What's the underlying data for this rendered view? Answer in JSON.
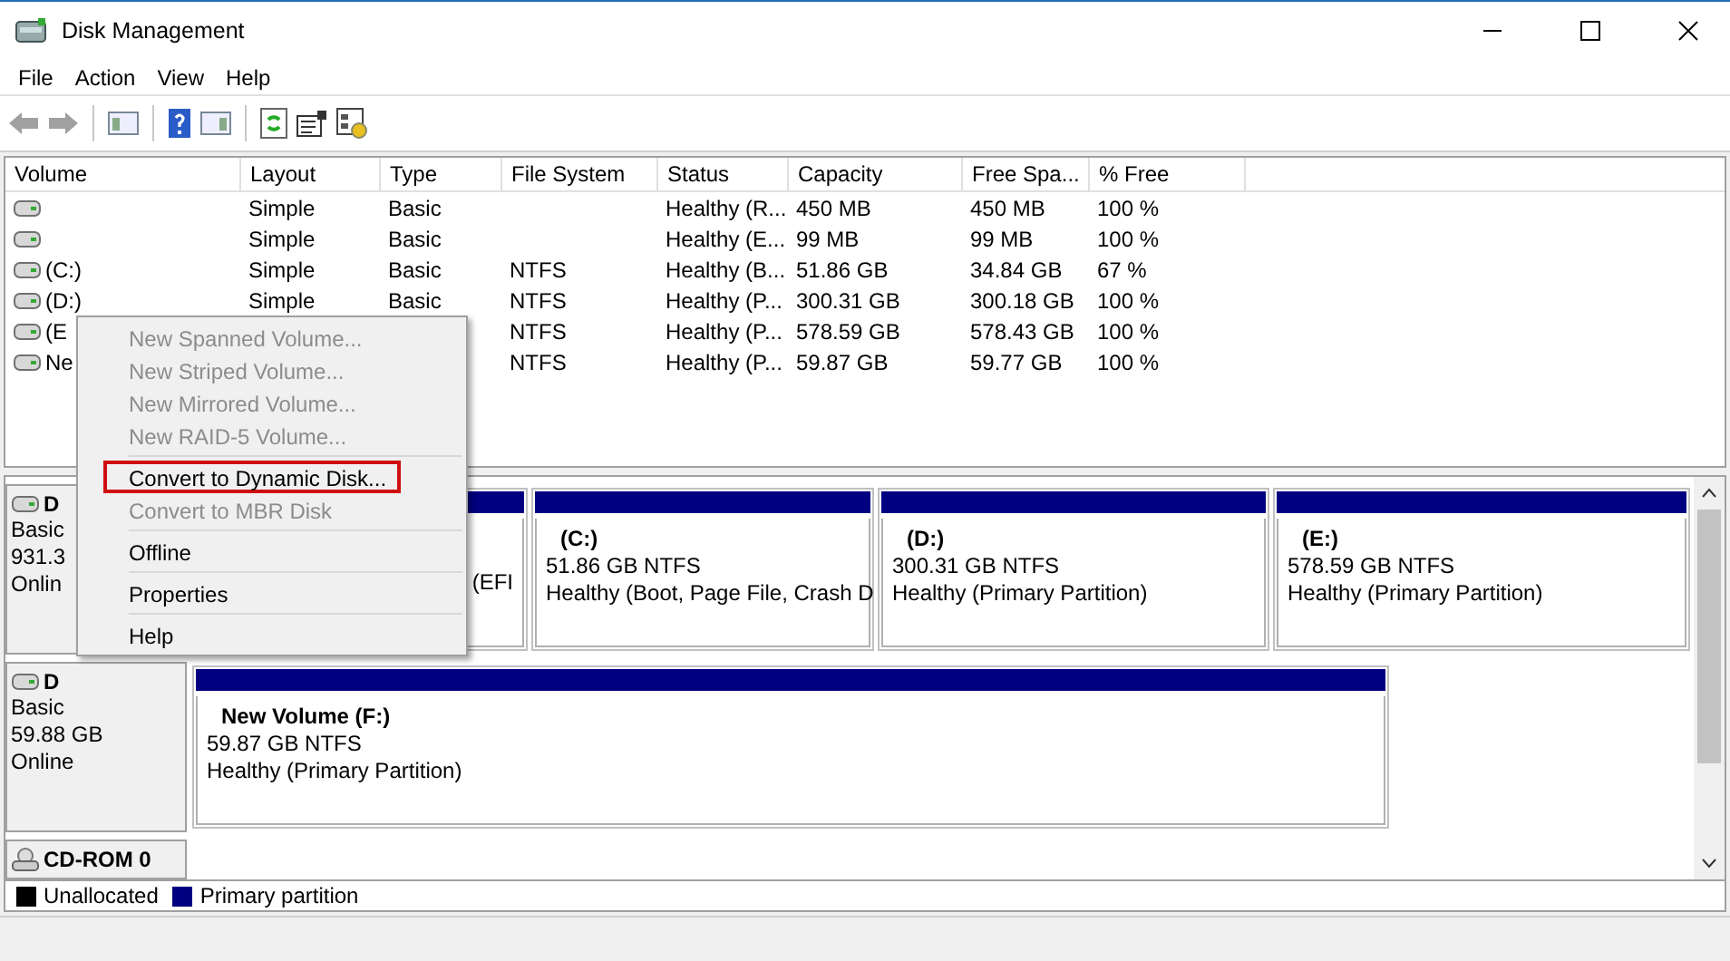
{
  "window": {
    "title": "Disk Management"
  },
  "menu_bar": [
    "File",
    "Action",
    "View",
    "Help"
  ],
  "toolbar": [
    {
      "kind": "back",
      "disabled": true
    },
    {
      "kind": "forward",
      "disabled": true
    },
    {
      "kind": "sep"
    },
    {
      "kind": "tree",
      "disabled": false
    },
    {
      "kind": "sep"
    },
    {
      "kind": "help",
      "disabled": false
    },
    {
      "kind": "pane",
      "disabled": false
    },
    {
      "kind": "sep"
    },
    {
      "kind": "refresh",
      "disabled": false
    },
    {
      "kind": "properties",
      "disabled": false
    },
    {
      "kind": "settings",
      "disabled": false
    }
  ],
  "table": {
    "columns": [
      "Volume",
      "Layout",
      "Type",
      "File System",
      "Status",
      "Capacity",
      "Free Spa...",
      "% Free"
    ],
    "rows": [
      [
        "",
        "Simple",
        "Basic",
        "",
        "Healthy (R...",
        "450 MB",
        "450 MB",
        "100 %"
      ],
      [
        "",
        "Simple",
        "Basic",
        "",
        "Healthy (E...",
        "99 MB",
        "99 MB",
        "100 %"
      ],
      [
        "(C:)",
        "Simple",
        "Basic",
        "NTFS",
        "Healthy (B...",
        "51.86 GB",
        "34.84 GB",
        "67 %"
      ],
      [
        "(D:)",
        "Simple",
        "Basic",
        "NTFS",
        "Healthy (P...",
        "300.31 GB",
        "300.18 GB",
        "100 %"
      ],
      [
        "(E",
        "",
        "",
        "NTFS",
        "Healthy (P...",
        "578.59 GB",
        "578.43 GB",
        "100 %"
      ],
      [
        "Ne",
        "",
        "",
        "NTFS",
        "Healthy (P...",
        "59.87 GB",
        "59.77 GB",
        "100 %"
      ]
    ]
  },
  "disks": [
    {
      "kind": "disk",
      "name": "D",
      "lines": [
        "Basic",
        "931.3",
        "Onlin"
      ],
      "partitions": [
        {
          "cut_left": true,
          "lines": [
            "(EFI"
          ]
        },
        {
          "cut_left": false,
          "name": "(C:)",
          "lines": [
            "51.86 GB NTFS",
            "Healthy (Boot, Page File, Crash D"
          ]
        },
        {
          "cut_left": false,
          "name": "(D:)",
          "lines": [
            "300.31 GB NTFS",
            "Healthy (Primary Partition)"
          ]
        },
        {
          "cut_left": false,
          "name": "(E:)",
          "lines": [
            "578.59 GB NTFS",
            "Healthy (Primary Partition)"
          ]
        }
      ]
    },
    {
      "kind": "disk",
      "name": "D",
      "lines": [
        "Basic",
        "59.88 GB",
        "Online"
      ],
      "partitions": [
        {
          "cut_left": false,
          "name": "New Volume (F:)",
          "lines": [
            "59.87 GB NTFS",
            "Healthy (Primary Partition)"
          ]
        }
      ]
    },
    {
      "kind": "cdrom",
      "name": "CD-ROM 0"
    }
  ],
  "legend": [
    {
      "label": "Unallocated",
      "color": "#000000"
    },
    {
      "label": "Primary partition",
      "color": "#000080"
    }
  ],
  "context_menu": [
    {
      "kind": "item",
      "label": "New Spanned Volume...",
      "disabled": true,
      "highlighted": false
    },
    {
      "kind": "item",
      "label": "New Striped Volume...",
      "disabled": true,
      "highlighted": false
    },
    {
      "kind": "item",
      "label": "New Mirrored Volume...",
      "disabled": true,
      "highlighted": false
    },
    {
      "kind": "item",
      "label": "New RAID-5 Volume...",
      "disabled": true,
      "highlighted": false
    },
    {
      "kind": "separator"
    },
    {
      "kind": "item",
      "label": "Convert to Dynamic Disk...",
      "disabled": false,
      "highlighted": true
    },
    {
      "kind": "item",
      "label": "Convert to MBR Disk",
      "disabled": true,
      "highlighted": false
    },
    {
      "kind": "separator"
    },
    {
      "kind": "item",
      "label": "Offline",
      "disabled": false,
      "highlighted": false
    },
    {
      "kind": "separator"
    },
    {
      "kind": "item",
      "label": "Properties",
      "disabled": false,
      "highlighted": false
    },
    {
      "kind": "separator"
    },
    {
      "kind": "item",
      "label": "Help",
      "disabled": false,
      "highlighted": false
    }
  ]
}
